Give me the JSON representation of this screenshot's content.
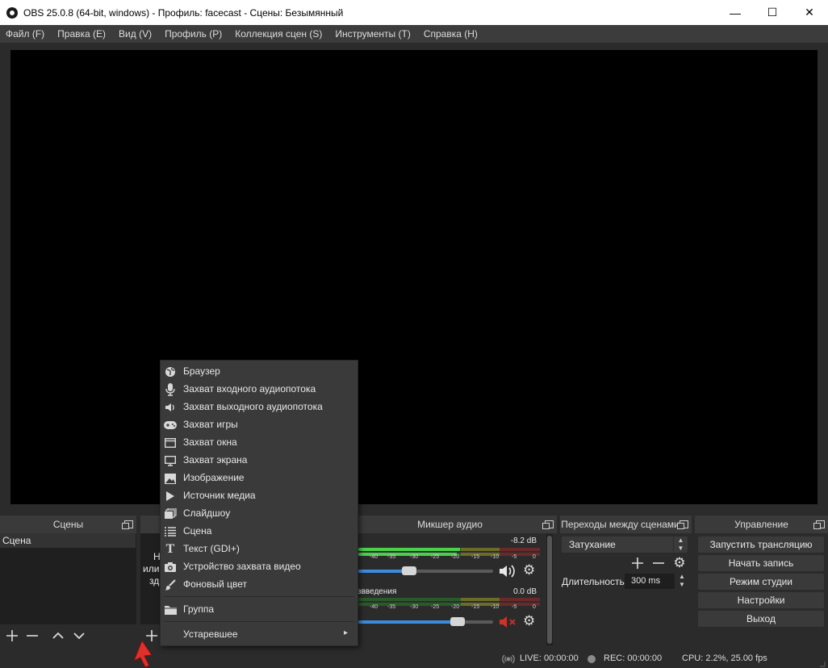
{
  "window": {
    "title": "OBS 25.0.8 (64-bit, windows) - Профиль: facecast - Сцены: Безымянный",
    "minimize": "—",
    "maximize": "☐",
    "close": "✕"
  },
  "menubar": {
    "items": [
      "Файл (F)",
      "Правка (E)",
      "Вид (V)",
      "Профиль (P)",
      "Коллекция сцен (S)",
      "Инструменты (T)",
      "Справка (H)"
    ]
  },
  "docks": {
    "scenes": {
      "title": "Сцены",
      "items": [
        "Сцена"
      ]
    },
    "sources": {
      "hint_lines": [
        "Н",
        "или",
        "зд"
      ]
    },
    "mixer": {
      "title": "Микшер аудио"
    },
    "transitions": {
      "title": "Переходы между сценами",
      "selected": "Затухание",
      "duration_label": "Длительность",
      "duration_value": "300 ms"
    },
    "controls": {
      "title": "Управление",
      "buttons": [
        "Запустить трансляцию",
        "Начать запись",
        "Режим студии",
        "Настройки",
        "Выход"
      ]
    }
  },
  "mixer": {
    "channels": [
      {
        "name": "",
        "db": "-8.2 dB",
        "level": 0.56,
        "volume": 0.38,
        "muted": false
      },
      {
        "name": "звведения",
        "db": "0.0 dB",
        "level": 0.0,
        "volume": 0.74,
        "muted": true
      }
    ],
    "ticks": [
      "-40",
      "-35",
      "-30",
      "-25",
      "-20",
      "-15",
      "-10",
      "-5",
      "0"
    ]
  },
  "context_menu": {
    "items": [
      {
        "label": "Браузер",
        "icon": "globe-icon"
      },
      {
        "label": "Захват входного аудиопотока",
        "icon": "microphone-icon"
      },
      {
        "label": "Захват выходного аудиопотока",
        "icon": "speaker-icon"
      },
      {
        "label": "Захват игры",
        "icon": "gamepad-icon"
      },
      {
        "label": "Захват окна",
        "icon": "window-icon"
      },
      {
        "label": "Захват экрана",
        "icon": "monitor-icon"
      },
      {
        "label": "Изображение",
        "icon": "image-icon"
      },
      {
        "label": "Источник медиа",
        "icon": "play-icon"
      },
      {
        "label": "Слайдшоу",
        "icon": "slideshow-icon"
      },
      {
        "label": "Сцена",
        "icon": "list-icon"
      },
      {
        "label": "Текст (GDI+)",
        "icon": "text-icon"
      },
      {
        "label": "Устройство захвата видео",
        "icon": "camera-icon"
      },
      {
        "label": "Фоновый цвет",
        "icon": "brush-icon"
      }
    ],
    "group": {
      "label": "Группа",
      "icon": "folder-icon"
    },
    "deprecated": {
      "label": "Устаревшее",
      "arrow": "▸"
    }
  },
  "status": {
    "live": "LIVE: 00:00:00",
    "rec": "REC: 00:00:00",
    "cpu": "CPU: 2.2%, 25.00 fps"
  },
  "colors": {
    "accent_blue": "#3d8bdc",
    "muted_red": "#d0302a",
    "cursor_red": "#e0302a"
  }
}
